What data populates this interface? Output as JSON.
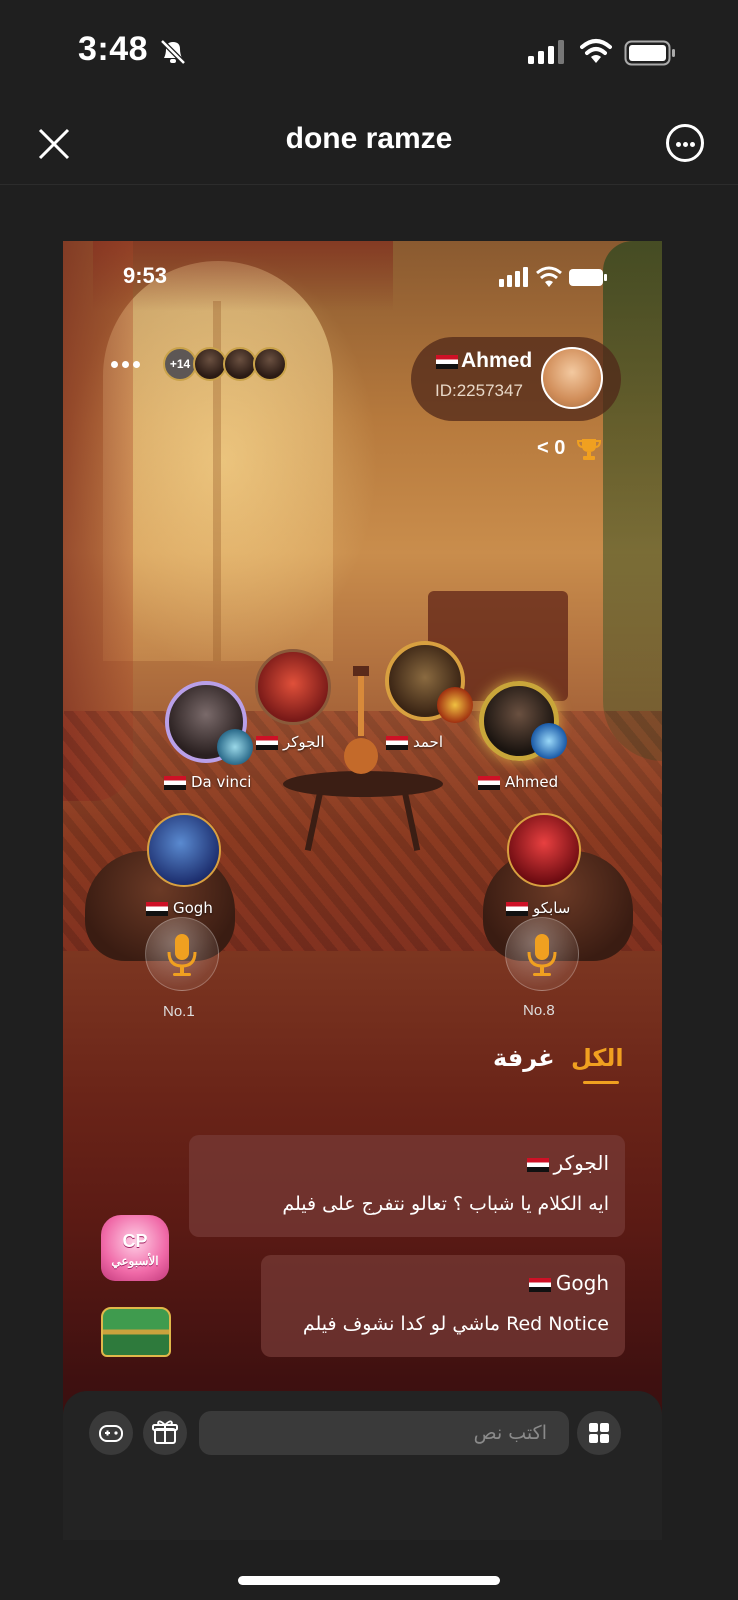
{
  "os_status": {
    "time": "3:48",
    "icons": [
      "bell-slash-icon",
      "cellular-icon",
      "wifi-icon",
      "battery-icon"
    ]
  },
  "nav": {
    "title": "done ramze",
    "close_icon": "close-icon",
    "more_icon": "more-icon"
  },
  "app": {
    "status": {
      "time": "9:53"
    },
    "profile": {
      "name": "Ahmed",
      "id": "ID:2257347"
    },
    "trophy": {
      "count": "0",
      "chevron": "<"
    },
    "viewers": {
      "extra_count": "+14"
    },
    "seats": [
      {
        "name": "الجوكر"
      },
      {
        "name": "احمد"
      },
      {
        "name": "Da vinci"
      },
      {
        "name": "Ahmed"
      },
      {
        "name": "Gogh"
      },
      {
        "name": "سابكو"
      }
    ],
    "mic_seats": [
      {
        "label": "No.1"
      },
      {
        "label": "No.8"
      }
    ],
    "tabs": {
      "all": "الكل",
      "room": "غرفة"
    },
    "messages": [
      {
        "name": "الجوكر",
        "text": "ايه الكلام يا شباب ؟ تعالو نتفرج على فيلم"
      },
      {
        "name": "Gogh",
        "text": "ماشي لو كدا نشوف فيلم Red Notice"
      }
    ],
    "cp_badge": {
      "text": "CP",
      "subtitle": "الأسبوعي"
    },
    "input": {
      "placeholder": "اكتب نص"
    }
  },
  "colors": {
    "accent": "#f0a020",
    "bubble": "#784037",
    "bar": "#232323"
  }
}
